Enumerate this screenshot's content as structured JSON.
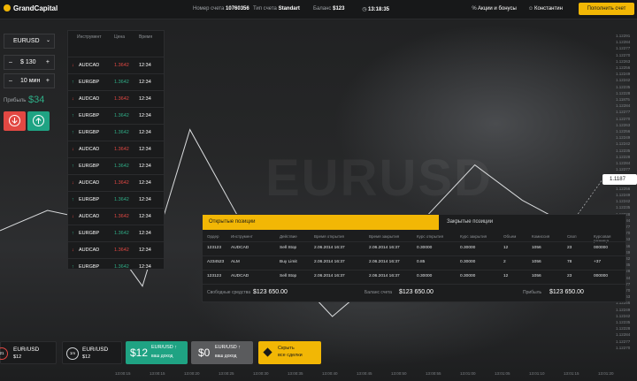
{
  "brand": {
    "name": "GrandCapital"
  },
  "header": {
    "account_label": "Номер счета",
    "account_value": "10760356",
    "type_label": "Тип счета",
    "type_value": "Standart",
    "balance_label": "Баланс",
    "balance_value": "$123",
    "time_value": "13:18:35",
    "promo_label": "Акции и бонусы",
    "user_name": "Константин",
    "deposit_label": "Пополнить счет"
  },
  "trade_panel": {
    "symbol": "EURUSD",
    "amount_minus": "–",
    "amount": "$ 130",
    "amount_plus": "+",
    "duration_minus": "–",
    "duration": "10 мин",
    "duration_plus": "+",
    "profit_label": "Прибыль",
    "profit_value": "$34"
  },
  "quotes": {
    "headers": [
      "Инструмент",
      "Цена",
      "Время"
    ],
    "rows": [
      {
        "instrument": "AUDCAD",
        "dir": "down",
        "price": "1.3642",
        "time": "12:34"
      },
      {
        "instrument": "EURGBP",
        "dir": "up",
        "price": "1.3642",
        "time": "12:34"
      },
      {
        "instrument": "AUDCAD",
        "dir": "down",
        "price": "1.3642",
        "time": "12:34"
      },
      {
        "instrument": "EURGBP",
        "dir": "up",
        "price": "1.3642",
        "time": "12:34"
      },
      {
        "instrument": "EURGBP",
        "dir": "up",
        "price": "1.3642",
        "time": "12:34"
      },
      {
        "instrument": "AUDCAD",
        "dir": "down",
        "price": "1.3642",
        "time": "12:34"
      },
      {
        "instrument": "EURGBP",
        "dir": "up",
        "price": "1.3642",
        "time": "12:34"
      },
      {
        "instrument": "AUDCAD",
        "dir": "down",
        "price": "1.3642",
        "time": "12:34"
      },
      {
        "instrument": "EURGBP",
        "dir": "up",
        "price": "1.3642",
        "time": "12:34"
      },
      {
        "instrument": "AUDCAD",
        "dir": "down",
        "price": "1.3642",
        "time": "12:34"
      },
      {
        "instrument": "EURGBP",
        "dir": "up",
        "price": "1.3642",
        "time": "12:34"
      },
      {
        "instrument": "AUDCAD",
        "dir": "down",
        "price": "1.3642",
        "time": "12:34"
      },
      {
        "instrument": "EURGBP",
        "dir": "up",
        "price": "1.3642",
        "time": "12:34"
      }
    ]
  },
  "chart": {
    "watermark": "EURUSD",
    "current_price": "1.1187",
    "price_ticks": [
      "1.12291",
      "1.12284",
      "1.12277",
      "1.12270",
      "1.12263",
      "1.12256",
      "1.12249",
      "1.12242",
      "1.12235",
      "1.12228",
      "1.11875",
      "1.12284",
      "1.12277",
      "1.12270",
      "1.12263",
      "1.12256",
      "1.12249",
      "1.12242",
      "1.12235",
      "1.12228",
      "1.12284",
      "1.12277",
      "1.12270",
      "1.12263",
      "1.12256",
      "1.12249",
      "1.12242",
      "1.12235",
      "1.12228",
      "1.12284",
      "1.12277",
      "1.12270",
      "1.12263",
      "1.12256",
      "1.12249",
      "1.12242",
      "1.12235",
      "1.12228",
      "1.12284",
      "1.12277",
      "1.12270",
      "1.12263",
      "1.12256",
      "1.12249",
      "1.12242",
      "1.12235",
      "1.12228",
      "1.12284",
      "1.12277",
      "1.12270"
    ],
    "time_ticks": [
      "13:00:15",
      "13:00:15",
      "13:00:20",
      "13:00:25",
      "13:00:30",
      "13:00:35",
      "13:00:40",
      "13:00:45",
      "13:00:50",
      "13:00:55",
      "13:01:00",
      "13:01:05",
      "13:01:10",
      "13:01:15",
      "13:01:20"
    ]
  },
  "chart_data": {
    "type": "line",
    "x": [
      0,
      1,
      2,
      3,
      4,
      5,
      6,
      7,
      8,
      9,
      10,
      11,
      12
    ],
    "series": [
      {
        "values": [
          1.12252,
          1.12256,
          1.12254,
          1.12241,
          1.12272,
          1.12255,
          1.12245,
          1.12235,
          1.12243,
          1.12255,
          1.12265,
          1.12258,
          1.12253
        ]
      }
    ],
    "ylim": [
      1.12228,
      1.12291
    ]
  },
  "positions": {
    "tab_open": "Открытые позиции",
    "tab_closed": "Закрытые позиции",
    "headers": [
      "Ордер",
      "Инструмент",
      "Действие",
      "Время открытия",
      "Время закрытия",
      "Курс открытия",
      "Курс закрытия",
      "Объем",
      "Комиссия",
      "Своп",
      "Курсовая разница"
    ],
    "rows": [
      [
        "123123",
        "AUDCAD",
        "Sell Stop",
        "2.06.2014  16:37",
        "2.06.2014  16:37",
        "0.30000",
        "0.30000",
        "12",
        "1056",
        "23",
        "000000"
      ],
      [
        "A234523",
        "ALM",
        "Buy Limit",
        "2.06.2014  16:37",
        "2.06.2014  16:37",
        "0.85",
        "0.30000",
        "2",
        "1056",
        "78",
        "+37"
      ],
      [
        "123123",
        "AUDCAD",
        "Sell Stop",
        "2.06.2014  16:37",
        "2.06.2014  16:37",
        "0.30000",
        "0.30000",
        "12",
        "1056",
        "23",
        "000000"
      ]
    ],
    "footer": {
      "free_label": "Свободные средства",
      "free_value": "$123 650.00",
      "balance_label": "Баланс счета",
      "balance_value": "$123 650.00",
      "profit_label": "Прибыль",
      "profit_value": "$123 650.00"
    }
  },
  "bottom_bar": {
    "card1": {
      "timer": "21",
      "pair": "EUR/USD",
      "amount": "$12"
    },
    "card2": {
      "timer": "1m",
      "pair": "EUR/USD",
      "amount": "$12"
    },
    "card3": {
      "big": "$12",
      "pair": "EUR/USD",
      "sub": "ваш доход"
    },
    "card4": {
      "big": "$0",
      "pair": "EUR/USD",
      "sub": "ваш доход"
    },
    "card5": {
      "line1": "Скрыть",
      "line2": "все сделки"
    }
  },
  "colors": {
    "accent": "#f2b705",
    "up": "#1fa383",
    "down": "#e24843"
  }
}
